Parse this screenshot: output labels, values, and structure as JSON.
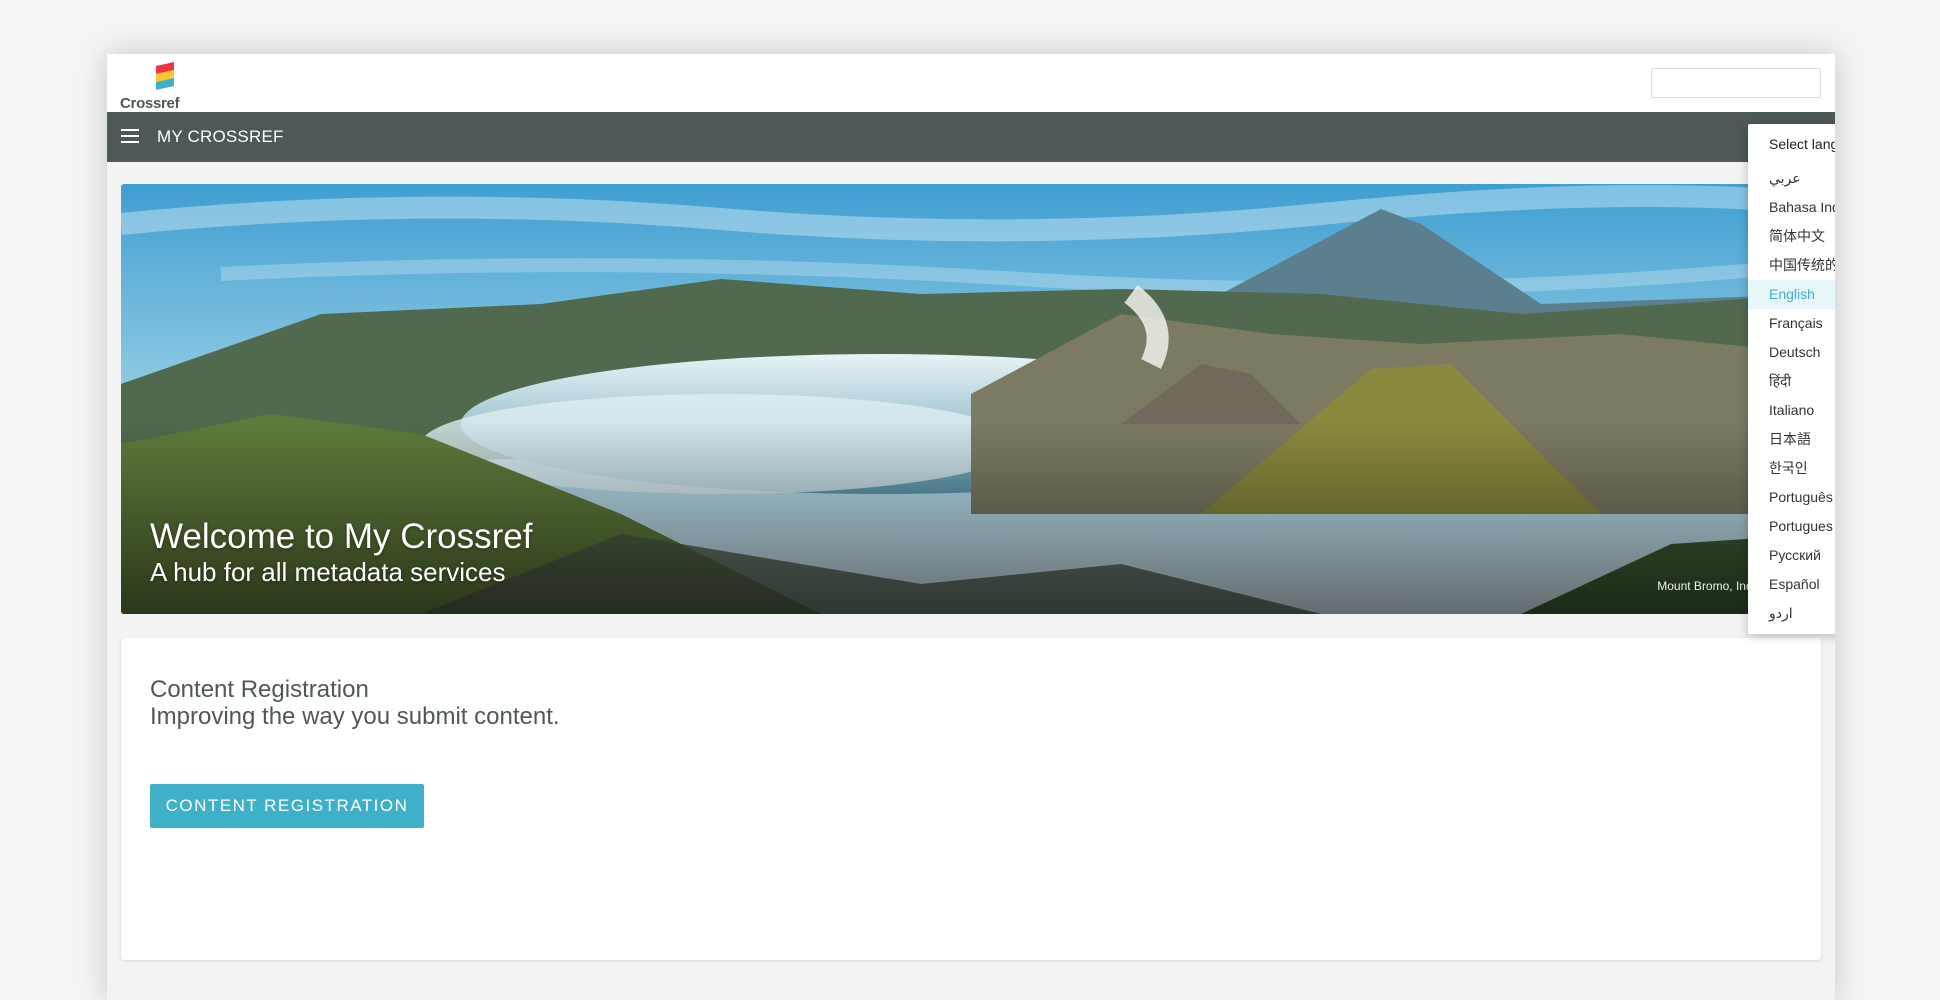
{
  "brand": {
    "name": "Crossref"
  },
  "nav": {
    "title": "MY CROSSREF"
  },
  "hero": {
    "title": "Welcome to My Crossref",
    "subtitle": "A hub for all metadata services",
    "credit": "Mount Bromo, Indonesia"
  },
  "content_card": {
    "title": "Content Registration",
    "subtitle": "Improving the way you submit content.",
    "button_label": "CONTENT REGISTRATION"
  },
  "language_dropdown": {
    "label": "Select language",
    "selected": "English",
    "options": [
      "عربي",
      "Bahasa Indonesia",
      "简体中文",
      "中国传统的",
      "English",
      "Français",
      "Deutsch",
      "हिंदी",
      "Italiano",
      "日本語",
      "한국인",
      "Português",
      "Portugues do Brasil",
      "Русский",
      "Español",
      "اردو"
    ]
  },
  "colors": {
    "navbar": "#4f5858",
    "accent": "#3eb1c8",
    "logo_red": "#ef3340",
    "logo_yellow": "#ffc72c",
    "logo_blue": "#3eb1c8"
  },
  "icons": [
    "crossref-logo-icon",
    "menu-icon",
    "chevron-up-icon"
  ]
}
